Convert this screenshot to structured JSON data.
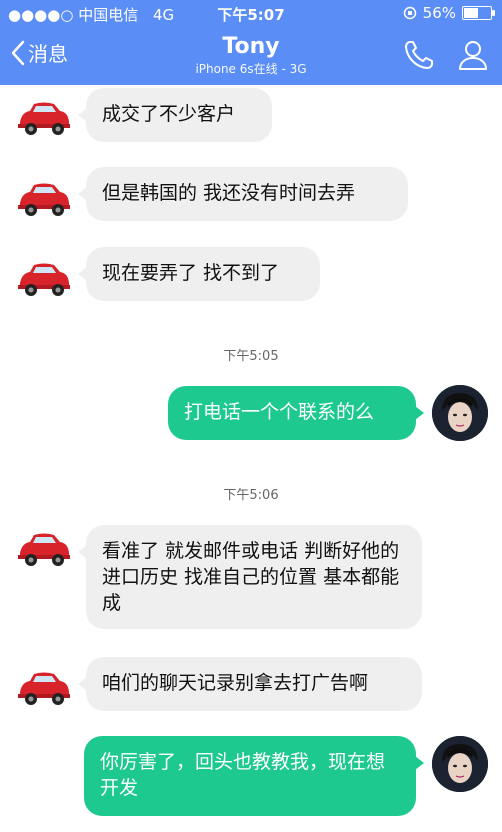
{
  "status_bar": {
    "carrier": "●●●●○ 中国电信",
    "network": "4G",
    "time": "下午5:07",
    "battery": "56%",
    "battery_level": 0.56
  },
  "header": {
    "back_label": "消息",
    "contact_name": "Tony",
    "contact_status": "iPhone 6s在线 - 3G",
    "phone_icon": "phone-icon",
    "profile_icon": "person-icon"
  },
  "messages": [
    {
      "side": "in",
      "text": "成交了不少客户"
    },
    {
      "side": "in",
      "text": "但是韩国的 我还没有时间去弄"
    },
    {
      "side": "in",
      "text": "现在要弄了 找不到了"
    },
    {
      "timestamp": "下午5:05"
    },
    {
      "side": "out",
      "text": "打电话一个个联系的么"
    },
    {
      "timestamp": "下午5:06"
    },
    {
      "side": "in",
      "text": "看准了 就发邮件或电话 判断好他的进口历史 找准自己的位置 基本都能成"
    },
    {
      "side": "in",
      "text": "咱们的聊天记录别拿去打广告啊"
    },
    {
      "side": "out",
      "text": "你厉害了，回头也教教我，现在想开发"
    }
  ],
  "colors": {
    "header_bg": "#5a8df5",
    "outgoing_bubble": "#1ec98f",
    "incoming_bubble": "#efefef"
  }
}
